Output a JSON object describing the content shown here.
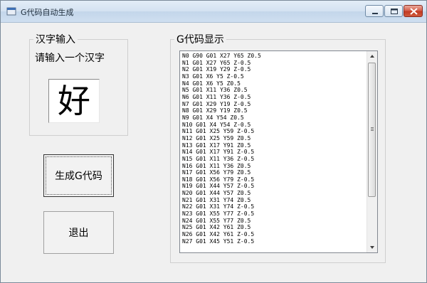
{
  "window": {
    "title": "G代码自动生成"
  },
  "input_group": {
    "legend": "汉字输入",
    "hint": "请输入一个汉字",
    "char_value": "好"
  },
  "buttons": {
    "generate": "生成G代码",
    "exit": "退出"
  },
  "output_group": {
    "legend": "G代码显示",
    "lines": [
      "N0 G90 G01 X27 Y65 Z0.5",
      "N1 G01 X27 Y65 Z-0.5",
      "N2 G01 X19 Y29 Z-0.5",
      "N3 G01 X6 Y5 Z-0.5",
      "N4 G01 X6 Y5 Z0.5",
      "N5 G01 X11 Y36 Z0.5",
      "N6 G01 X11 Y36 Z-0.5",
      "N7 G01 X29 Y19 Z-0.5",
      "N8 G01 X29 Y19 Z0.5",
      "N9 G01 X4 Y54 Z0.5",
      "N10 G01 X4 Y54 Z-0.5",
      "N11 G01 X25 Y59 Z-0.5",
      "N12 G01 X25 Y59 Z0.5",
      "N13 G01 X17 Y91 Z0.5",
      "N14 G01 X17 Y91 Z-0.5",
      "N15 G01 X11 Y36 Z-0.5",
      "N16 G01 X11 Y36 Z0.5",
      "N17 G01 X56 Y79 Z0.5",
      "N18 G01 X56 Y79 Z-0.5",
      "N19 G01 X44 Y57 Z-0.5",
      "N20 G01 X44 Y57 Z0.5",
      "N21 G01 X31 Y74 Z0.5",
      "N22 G01 X31 Y74 Z-0.5",
      "N23 G01 X55 Y77 Z-0.5",
      "N24 G01 X55 Y77 Z0.5",
      "N25 G01 X42 Y61 Z0.5",
      "N26 G01 X42 Y61 Z-0.5",
      "N27 G01 X45 Y51 Z-0.5"
    ]
  },
  "icons": {
    "app": "app-icon",
    "minimize": "minimize-icon",
    "maximize": "maximize-icon",
    "close": "close-icon"
  }
}
